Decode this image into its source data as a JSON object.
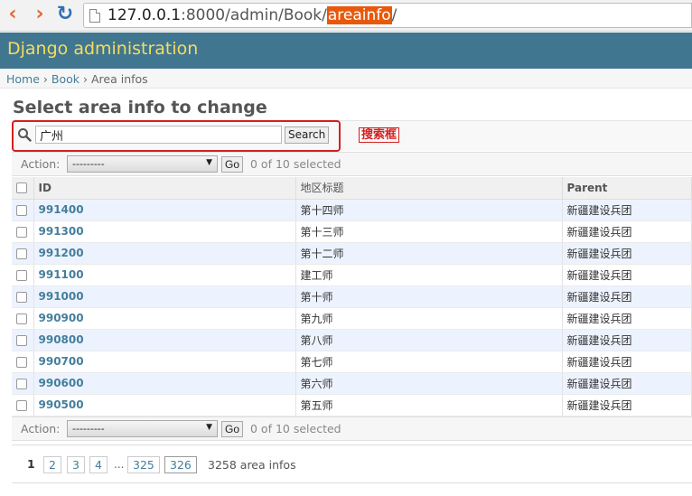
{
  "browser": {
    "back_icon": "‹",
    "forward_icon": "›",
    "reload_icon": "↻",
    "url_host": "127.0.0.1",
    "url_path_pre": ":8000/admin/Book/",
    "url_highlight": "areainfo",
    "url_path_post": "/"
  },
  "header": {
    "title": "Django administration"
  },
  "breadcrumbs": {
    "home": "Home",
    "app": "Book",
    "current": "Area infos",
    "sep": "›"
  },
  "page_title": "Select area info to change",
  "search": {
    "value": "广州",
    "button": "Search",
    "annotation": "搜索框"
  },
  "actions": {
    "label": "Action:",
    "selected_option": "---------",
    "go": "Go",
    "count": "0 of 10 selected"
  },
  "table": {
    "headers": {
      "id": "ID",
      "title": "地区标题",
      "parent": "Parent"
    },
    "rows": [
      {
        "id": "991400",
        "title": "第十四师",
        "parent": "新疆建设兵团"
      },
      {
        "id": "991300",
        "title": "第十三师",
        "parent": "新疆建设兵团"
      },
      {
        "id": "991200",
        "title": "第十二师",
        "parent": "新疆建设兵团"
      },
      {
        "id": "991100",
        "title": "建工师",
        "parent": "新疆建设兵团"
      },
      {
        "id": "991000",
        "title": "第十师",
        "parent": "新疆建设兵团"
      },
      {
        "id": "990900",
        "title": "第九师",
        "parent": "新疆建设兵团"
      },
      {
        "id": "990800",
        "title": "第八师",
        "parent": "新疆建设兵团"
      },
      {
        "id": "990700",
        "title": "第七师",
        "parent": "新疆建设兵团"
      },
      {
        "id": "990600",
        "title": "第六师",
        "parent": "新疆建设兵团"
      },
      {
        "id": "990500",
        "title": "第五师",
        "parent": "新疆建设兵团"
      }
    ]
  },
  "pagination": {
    "current": "1",
    "pages": [
      "2",
      "3",
      "4"
    ],
    "ellipsis": "...",
    "last_pages": [
      "325",
      "326"
    ],
    "count": "3258 area infos"
  },
  "colors": {
    "header_bg": "#417690",
    "header_title": "#f5dd5d",
    "link": "#447e9b",
    "annotation": "#d42020",
    "url_highlight": "#e8590c"
  }
}
